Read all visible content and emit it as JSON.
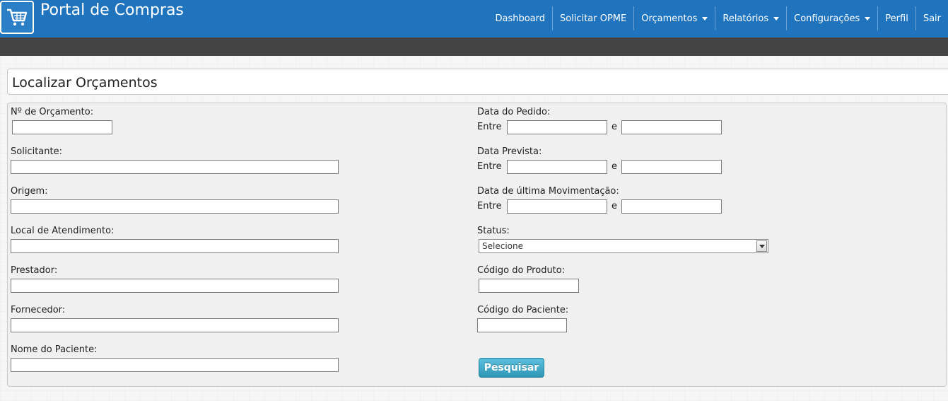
{
  "app": {
    "brand": "Portal de Compras",
    "logo_icon": "shopping-cart-icon"
  },
  "nav": {
    "items": [
      {
        "label": "Dashboard"
      },
      {
        "label": "Solicitar OPME"
      },
      {
        "label": "Orçamentos",
        "dropdown": true
      },
      {
        "label": "Relatórios",
        "dropdown": true
      },
      {
        "label": "Configurações",
        "dropdown": true
      },
      {
        "label": "Perfil"
      },
      {
        "label": "Sair"
      }
    ]
  },
  "page": {
    "title": "Localizar Orçamentos"
  },
  "form": {
    "left": {
      "numero_orcamento": {
        "label": "Nº de Orçamento:",
        "value": ""
      },
      "solicitante": {
        "label": "Solicitante:",
        "value": ""
      },
      "origem": {
        "label": "Origem:",
        "value": ""
      },
      "local_atendimento": {
        "label": "Local de Atendimento:",
        "value": ""
      },
      "prestador": {
        "label": "Prestador:",
        "value": ""
      },
      "fornecedor": {
        "label": "Fornecedor:",
        "value": ""
      },
      "nome_paciente": {
        "label": "Nome do Paciente:",
        "value": ""
      }
    },
    "right": {
      "data_pedido": {
        "label": "Data do Pedido:",
        "between": "Entre",
        "and": "e",
        "from": "",
        "to": ""
      },
      "data_prevista": {
        "label": "Data Prevista:",
        "between": "Entre",
        "and": "e",
        "from": "",
        "to": ""
      },
      "data_ultima_mov": {
        "label": "Data de última Movimentação:",
        "between": "Entre",
        "and": "e",
        "from": "",
        "to": ""
      },
      "status": {
        "label": "Status:",
        "selected": "Selecione"
      },
      "codigo_produto": {
        "label": "Código do Produto:",
        "value": ""
      },
      "codigo_paciente": {
        "label": "Código do Paciente:",
        "value": ""
      }
    },
    "submit_label": "Pesquisar"
  },
  "colors": {
    "header": "#1f74bd",
    "subbar": "#444444",
    "button": "#49afcd"
  }
}
